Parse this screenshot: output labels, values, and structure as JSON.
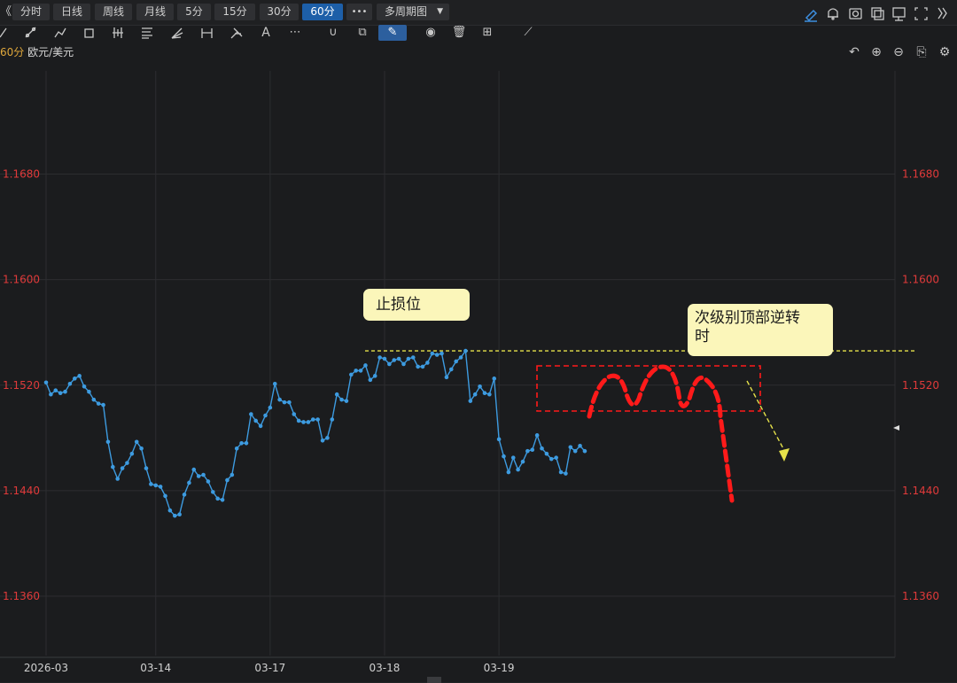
{
  "toolbar": {
    "collapse_left": "《",
    "periods": [
      "分时",
      "日线",
      "周线",
      "月线",
      "5分",
      "15分",
      "30分",
      "60分"
    ],
    "active_period": "60分",
    "more_label": "•••",
    "multi_period_label": "多周期图",
    "right_icons": [
      "pencil-icon",
      "bell-icon",
      "camera-icon",
      "copy-window-icon",
      "monitor-icon",
      "fullscreen-icon",
      "collapse-right-icon"
    ]
  },
  "drawing_tools": {
    "icons": [
      "line-tool-icon",
      "ray-tool-icon",
      "polyline-tool-icon",
      "rectangle-tool-icon",
      "bar-pattern-icon",
      "fibonacci-icon",
      "fan-icon",
      "measure-icon",
      "pitchfork-icon",
      "text-tool-icon",
      "more-tools-icon",
      "magnet-icon",
      "layers-icon",
      "pen-icon",
      "eye-icon",
      "trash-icon",
      "settings-grid-icon",
      "ruler-icon"
    ]
  },
  "chart_header": {
    "period": "60分",
    "symbol": "欧元/美元",
    "controls": [
      "undo-icon",
      "zoom-in-icon",
      "zoom-out-icon",
      "save-layout-icon",
      "settings-icon"
    ]
  },
  "colors": {
    "price_line": "#3d9be0",
    "axis_label": "#e03a3a",
    "stop_line": "#e6e24a",
    "pattern": "#ff1a1a",
    "note_bg": "#fbf6ba"
  },
  "annotations": {
    "stop_loss_label": "止损位",
    "reversal_label_line1": "次级别顶部逆转",
    "reversal_label_line2": "时"
  },
  "chart_data": {
    "type": "line",
    "title": "",
    "xlabel": "",
    "ylabel": "",
    "ylim": [
      1.1315,
      1.1765
    ],
    "y_ticks": [
      "1.1680",
      "1.1600",
      "1.1520",
      "1.1440",
      "1.1360"
    ],
    "y_tick_values": [
      1.168,
      1.16,
      1.152,
      1.144,
      1.136
    ],
    "x_ticks": [
      "2026-03",
      "03-14",
      "03-17",
      "03-18",
      "03-19"
    ],
    "x_tick_index": [
      0,
      23,
      47,
      71,
      95
    ],
    "grid": true,
    "legend": "none",
    "stop_loss_level": 1.1546,
    "series": [
      {
        "values": [
          1.1522,
          1.1513,
          1.1516,
          1.1514,
          1.1515,
          1.1521,
          1.1525,
          1.1527,
          1.1519,
          1.1515,
          1.1509,
          1.1506,
          1.1505,
          1.1477,
          1.1458,
          1.1449,
          1.1457,
          1.1461,
          1.1468,
          1.1477,
          1.1472,
          1.1457,
          1.1445,
          1.1444,
          1.1443,
          1.1436,
          1.1425,
          1.1421,
          1.1422,
          1.1437,
          1.1446,
          1.1456,
          1.1451,
          1.1452,
          1.1447,
          1.1439,
          1.1434,
          1.1433,
          1.1448,
          1.1452,
          1.1472,
          1.1476,
          1.1476,
          1.1498,
          1.1493,
          1.1489,
          1.1497,
          1.1503,
          1.1521,
          1.1509,
          1.1507,
          1.1507,
          1.1498,
          1.1493,
          1.1492,
          1.1492,
          1.1494,
          1.1494,
          1.1478,
          1.148,
          1.1494,
          1.1513,
          1.1509,
          1.1508,
          1.1528,
          1.1531,
          1.1531,
          1.1535,
          1.1524,
          1.1527,
          1.1541,
          1.154,
          1.1536,
          1.1539,
          1.154,
          1.1536,
          1.154,
          1.1541,
          1.1534,
          1.1534,
          1.1537,
          1.1544,
          1.1543,
          1.1544,
          1.1526,
          1.1532,
          1.1538,
          1.1541,
          1.1546,
          1.1508,
          1.1513,
          1.1519,
          1.1514,
          1.1513,
          1.1525,
          1.1479,
          1.1466,
          1.1454,
          1.1465,
          1.1456,
          1.1462,
          1.147,
          1.1471,
          1.1482,
          1.1472,
          1.1468,
          1.1464,
          1.1465,
          1.1454,
          1.1453,
          1.1473,
          1.147,
          1.1474,
          1.147
        ]
      }
    ]
  }
}
